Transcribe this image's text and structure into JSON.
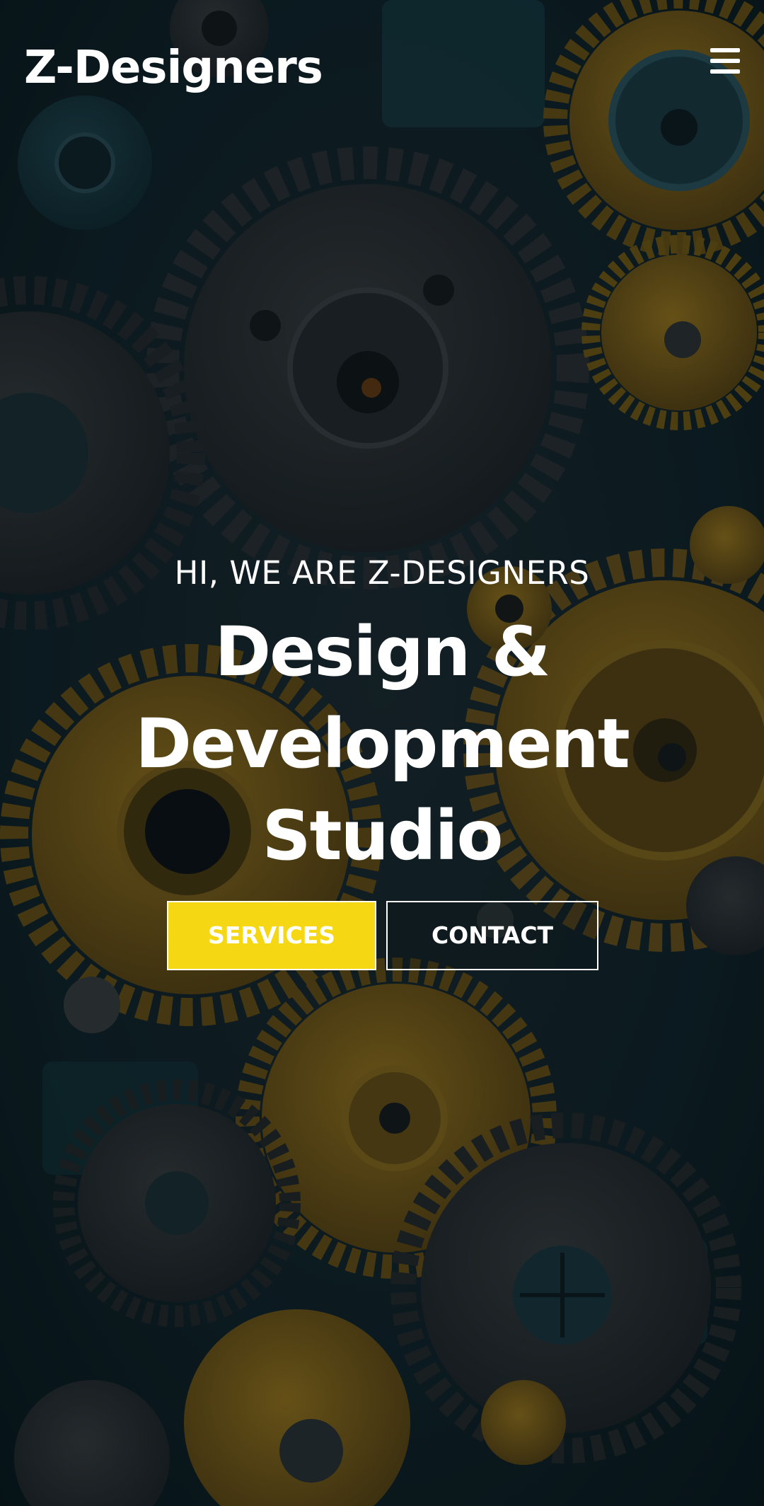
{
  "header": {
    "logo": "Z-Designers",
    "menu_icon": "hamburger-menu-icon"
  },
  "hero": {
    "eyebrow": "HI, WE ARE Z-DESIGNERS",
    "headline": "Design & Development Studio",
    "background": "gears-photo"
  },
  "cta": {
    "services_label": "SERVICES",
    "contact_label": "CONTACT"
  },
  "colors": {
    "accent": "#f5d713",
    "text": "#ffffff",
    "overlay": "#0b1c22"
  }
}
